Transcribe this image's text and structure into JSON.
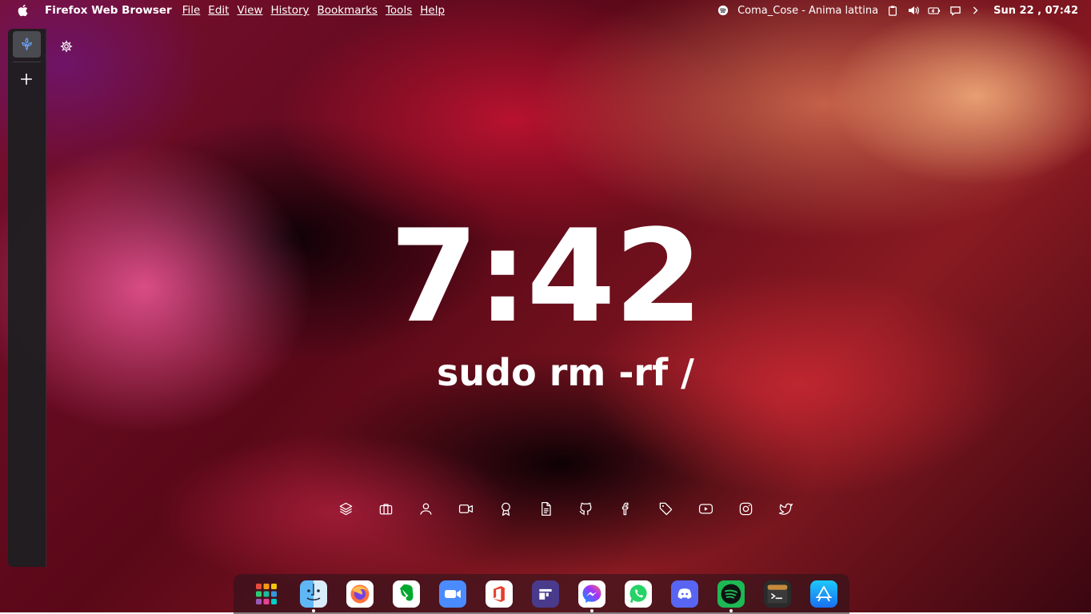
{
  "menubar": {
    "app_name": "Firefox Web Browser",
    "menus": [
      "File",
      "Edit",
      "View",
      "History",
      "Bookmarks",
      "Tools",
      "Help"
    ],
    "now_playing": "Coma_Cose - Anima lattina",
    "datetime": "Sun 22 , 07:42"
  },
  "newtab": {
    "clock": "7:42",
    "motto": "sudo rm -rf /",
    "links": [
      "stack-icon",
      "briefcase-icon",
      "user-icon",
      "video-icon",
      "award-icon",
      "file-text-icon",
      "github-icon",
      "facebook-icon",
      "tag-icon",
      "youtube-icon",
      "instagram-icon",
      "twitter-icon"
    ]
  },
  "dock": {
    "apps": [
      "App Launcher",
      "Finder",
      "Firefox",
      "Evernote",
      "Zoom",
      "Office",
      "Planner",
      "Messenger",
      "WhatsApp",
      "Discord",
      "Spotify",
      "Terminal",
      "App Store"
    ]
  },
  "colors": {
    "sidebar": "#1e1e20",
    "spotify": "#1db954",
    "discord": "#5865f2",
    "whatsapp": "#25d366"
  }
}
